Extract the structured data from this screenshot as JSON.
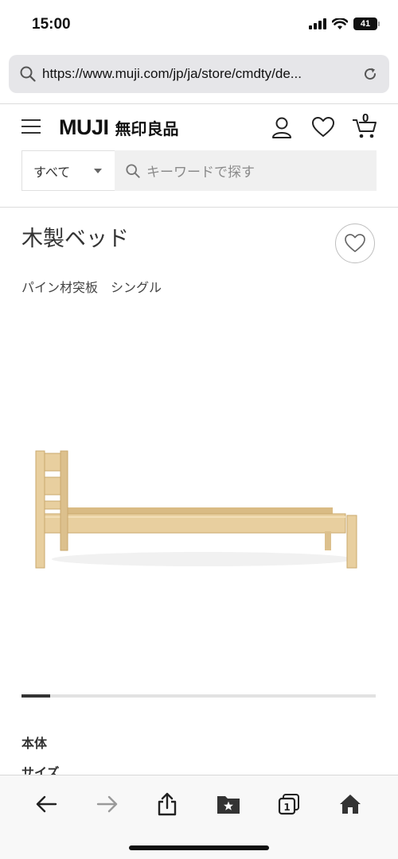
{
  "status_bar": {
    "time": "15:00",
    "battery": "41"
  },
  "browser": {
    "url": "https://www.muji.com/jp/ja/store/cmdty/de...",
    "toolbar": {
      "back": "back-arrow-icon",
      "forward": "forward-arrow-icon",
      "share": "share-icon",
      "bookmarks": "bookmarks-icon",
      "tabs_count": "1",
      "home": "home-icon"
    }
  },
  "header": {
    "logo_latin": "MUJI",
    "logo_jp": "無印良品",
    "cart_count": "0"
  },
  "search": {
    "category": "すべて",
    "placeholder": "キーワードで探す"
  },
  "product": {
    "title": "木製ベッド",
    "subtitle": "パイン材突板　シングル",
    "carousel_progress": 0.08
  },
  "specs": {
    "heading": "本体",
    "first_item": "サイズ"
  },
  "colors": {
    "wood": "#e8cf9f",
    "wood_dark": "#d9bb84",
    "text": "#333333"
  }
}
